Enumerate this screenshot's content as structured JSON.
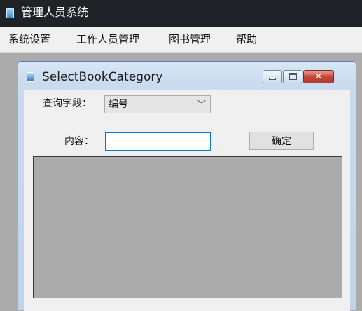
{
  "app": {
    "title": "管理人员系统",
    "icon": "app-icon"
  },
  "menu": {
    "items": [
      {
        "label": "系统设置"
      },
      {
        "label": "工作人员管理"
      },
      {
        "label": "图书管理"
      },
      {
        "label": "帮助"
      }
    ]
  },
  "child_window": {
    "title": "SelectBookCategory",
    "icon": "window-icon",
    "controls": {
      "minimize": "minimize-icon",
      "maximize": "maximize-icon",
      "close": "close-icon"
    },
    "close_glyph": "✕"
  },
  "form": {
    "field_label": "查询字段：",
    "field_select": {
      "selected": "编号",
      "arrow_glyph": "﹀"
    },
    "content_label": "内容：",
    "content_value": "",
    "confirm_label": "确定"
  },
  "colors": {
    "titlebar": "#1f2328",
    "mdi_background": "#ababab",
    "input_focus_border": "#0078d7"
  }
}
